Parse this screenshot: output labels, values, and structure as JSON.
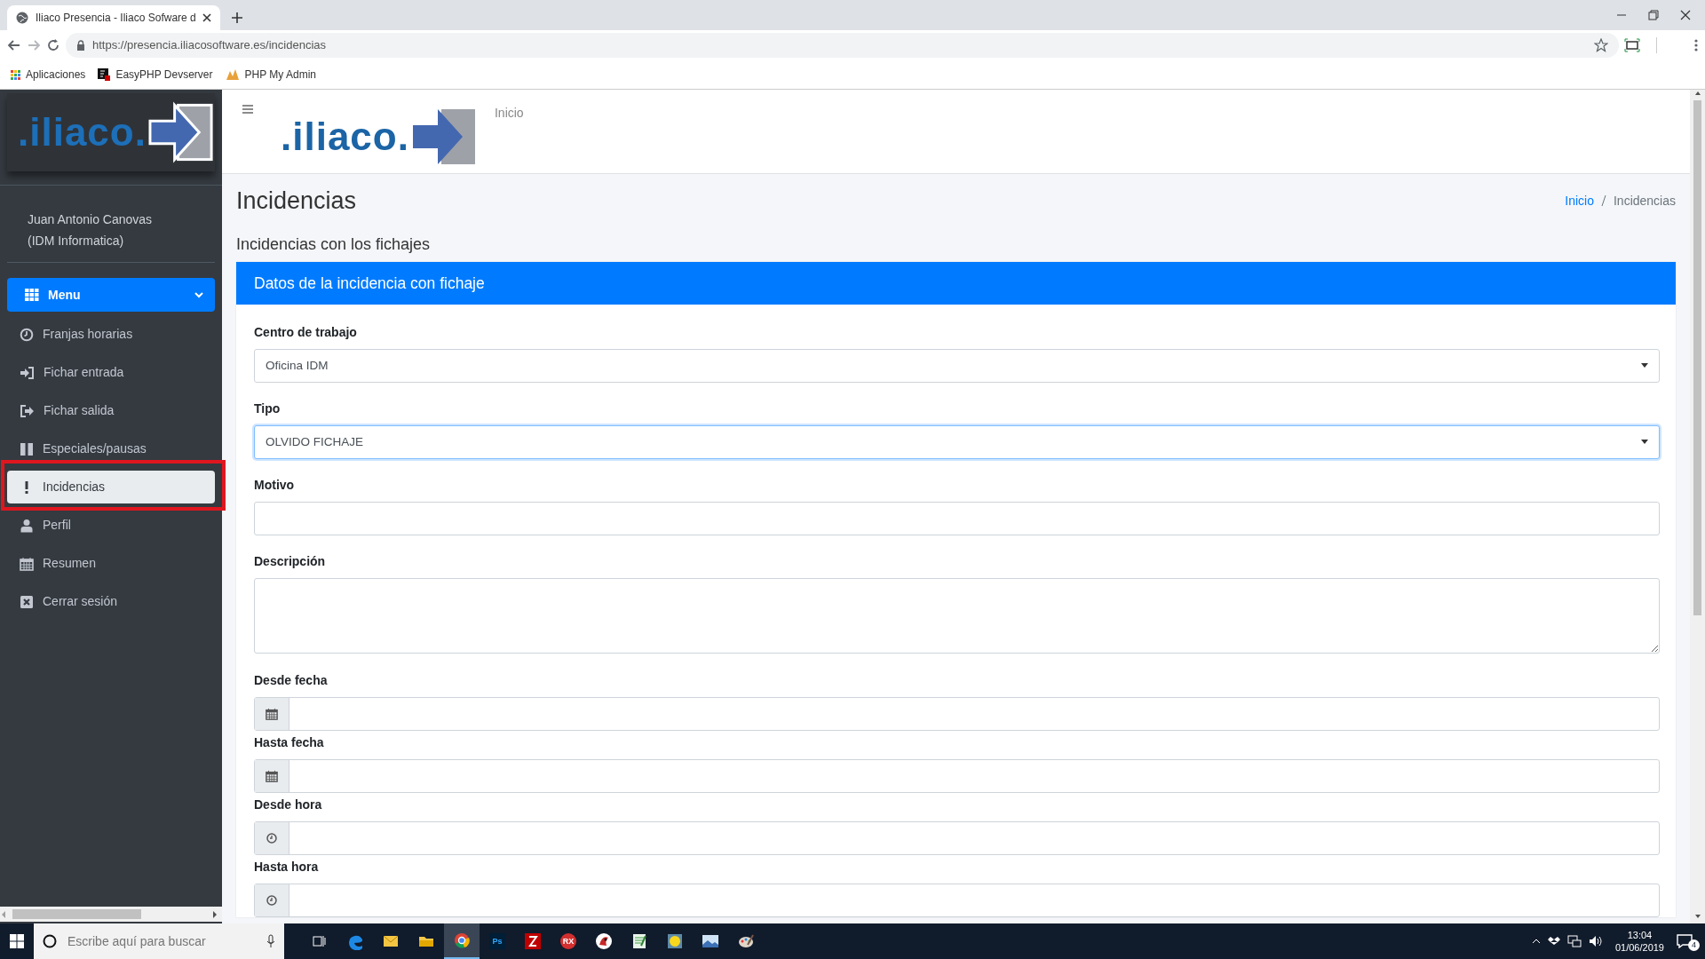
{
  "browser": {
    "tab_title": "Iliaco Presencia - Iliaco Sofware d",
    "url": "https://presencia.iliacosoftware.es/incidencias",
    "bookmarks": [
      "Aplicaciones",
      "EasyPHP Devserver",
      "PHP My Admin"
    ]
  },
  "sidebar": {
    "logo_text": ".iliaco.",
    "user_name": "Juan Antonio Canovas",
    "user_company": "(IDM Informatica)",
    "menu": {
      "label": "Menu",
      "expanded": true
    },
    "items": [
      {
        "label": "Franjas horarias",
        "selected": false,
        "outlined": false
      },
      {
        "label": "Fichar entrada",
        "selected": false,
        "outlined": false
      },
      {
        "label": "Fichar salida",
        "selected": false,
        "outlined": false
      },
      {
        "label": "Especiales/pausas",
        "selected": false,
        "outlined": false
      },
      {
        "label": "Incidencias",
        "selected": true,
        "outlined": true
      },
      {
        "label": "Perfil",
        "selected": false,
        "outlined": false
      },
      {
        "label": "Resumen",
        "selected": false,
        "outlined": false
      },
      {
        "label": "Cerrar sesión",
        "selected": false,
        "outlined": false
      }
    ]
  },
  "header": {
    "logo_text": ".iliaco.",
    "nav_link": "Inicio"
  },
  "page": {
    "title": "Incidencias",
    "breadcrumb": [
      {
        "label": "Inicio",
        "selected": false
      },
      {
        "label": "Incidencias",
        "selected": true
      }
    ],
    "section_title": "Incidencias con los fichajes",
    "card_title": "Datos de la incidencia con fichaje",
    "fields": [
      {
        "label": "Centro de trabajo",
        "kind": "select",
        "value": "Oficina IDM",
        "focused": false
      },
      {
        "label": "Tipo",
        "kind": "select",
        "value": "OLVIDO FICHAJE",
        "focused": true
      },
      {
        "label": "Motivo",
        "kind": "input",
        "focused": false
      },
      {
        "label": "Descripción",
        "kind": "textarea",
        "focused": false
      },
      {
        "label": "Desde fecha",
        "kind": "date",
        "focused": false
      },
      {
        "label": "Hasta fecha",
        "kind": "date",
        "focused": false
      },
      {
        "label": "Desde hora",
        "kind": "time",
        "focused": false
      },
      {
        "label": "Hasta hora",
        "kind": "time",
        "focused": false
      }
    ]
  },
  "taskbar": {
    "search_placeholder": "Escribe aquí para buscar",
    "apps": [
      {
        "selected": false
      },
      {
        "selected": false
      },
      {
        "selected": false
      },
      {
        "selected": true
      },
      {
        "label": "Ps",
        "selected": false
      },
      {
        "selected": false
      },
      {
        "label": "RX",
        "selected": false
      },
      {
        "selected": false
      },
      {
        "selected": false
      },
      {
        "selected": false
      },
      {
        "selected": false
      },
      {
        "selected": false
      }
    ],
    "time": "13:04",
    "date": "01/06/2019",
    "notifications": "4"
  }
}
